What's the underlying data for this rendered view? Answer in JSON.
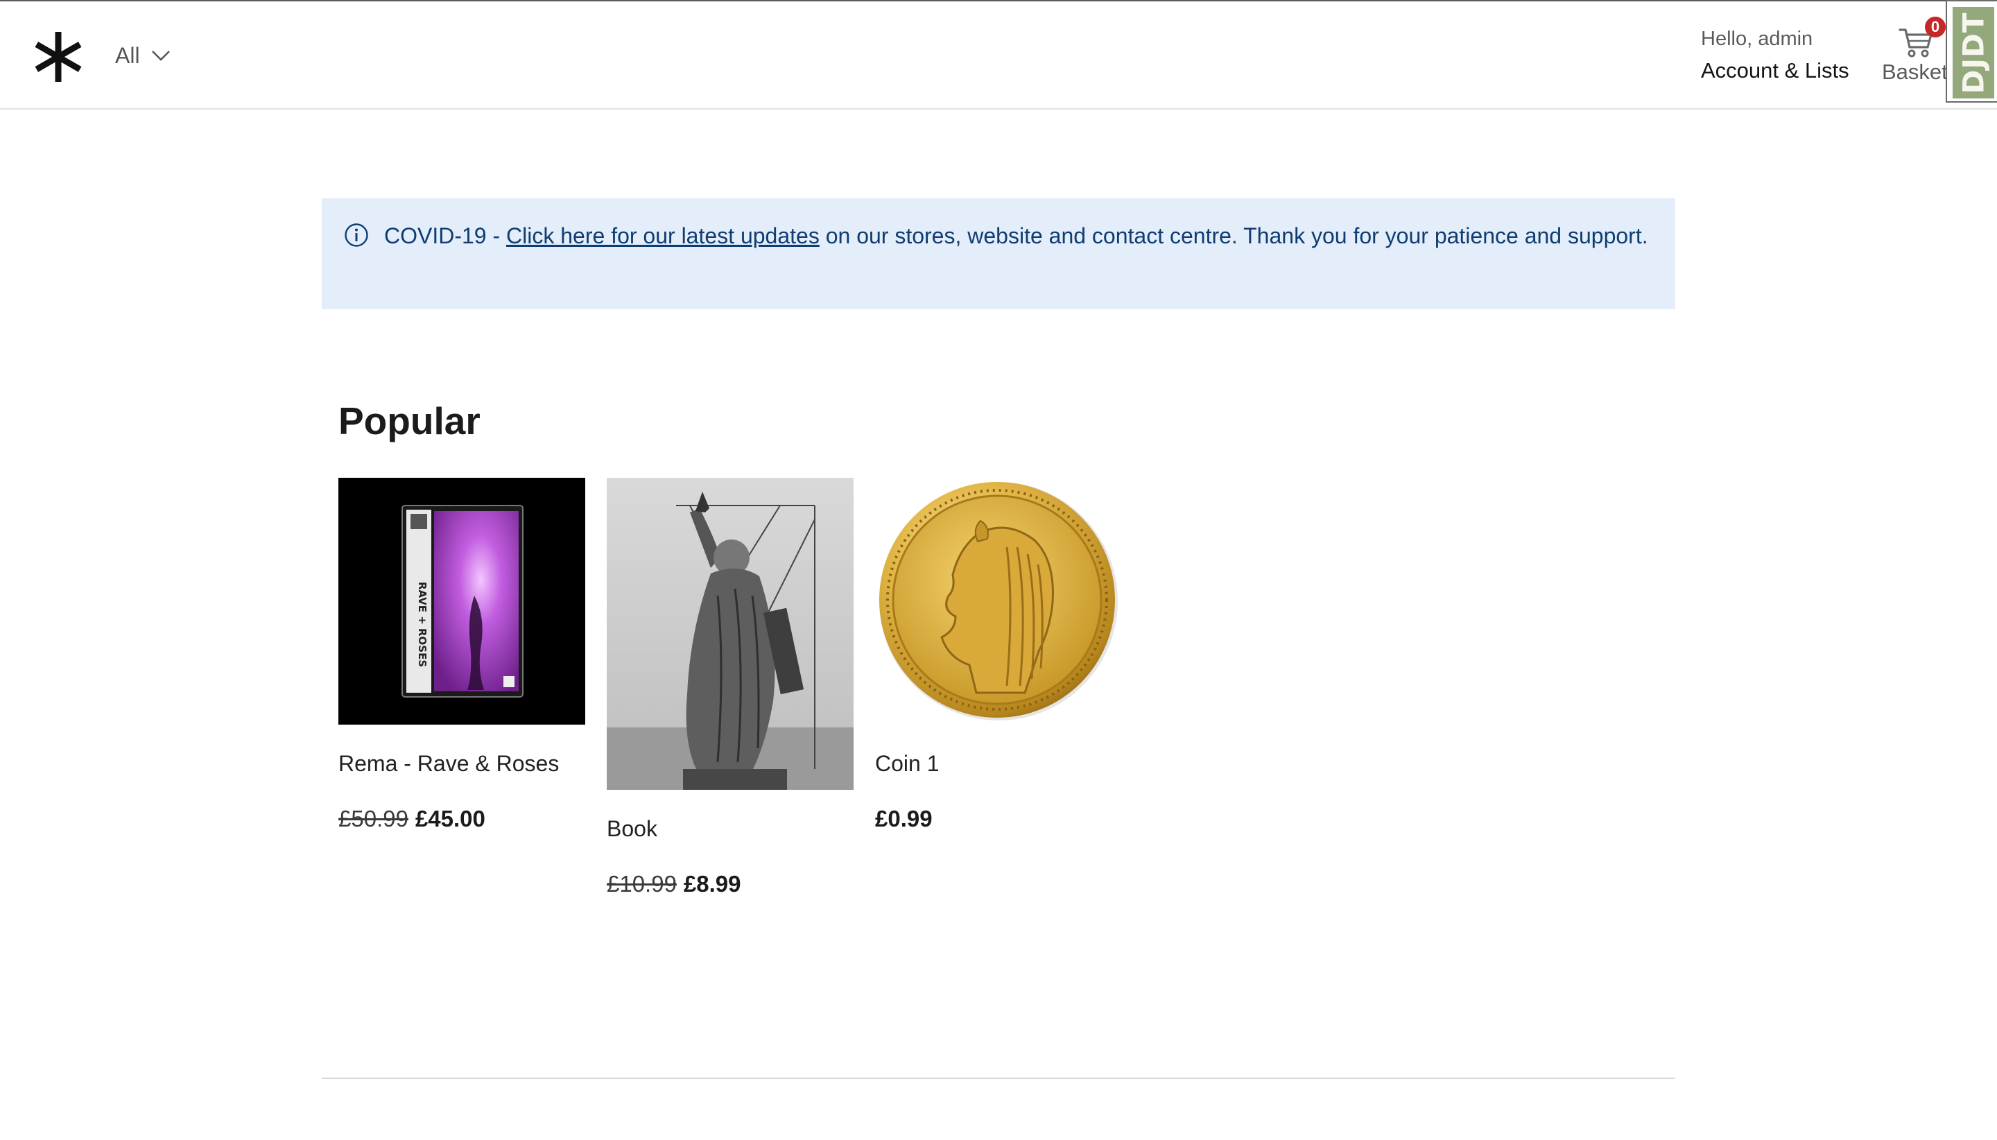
{
  "header": {
    "department_label": "All",
    "greeting": "Hello, admin",
    "account_title": "Account & Lists",
    "basket_count": "0",
    "basket_label": "Basket",
    "debug_toolbar_label": "DJDT"
  },
  "notice": {
    "prefix": "COVID-19 - ",
    "link_text": "Click here for our latest updates",
    "suffix": " on our stores, website and contact centre. Thank you for your patience and support."
  },
  "popular": {
    "title": "Popular",
    "products": [
      {
        "name": "Rema - Rave & Roses",
        "old_price": "£50.99",
        "price": "£45.00",
        "cover_text": "RAVE + ROSES"
      },
      {
        "name": "Book",
        "old_price": "£10.99",
        "price": "£8.99"
      },
      {
        "name": "Coin 1",
        "old_price": "",
        "price": "£0.99"
      }
    ]
  },
  "colors": {
    "notice_bg": "#e4eefa",
    "notice_text": "#0f3d72",
    "badge": "#c62828",
    "djdt": "#93a97c",
    "cover_purple": "#b04ad0"
  }
}
